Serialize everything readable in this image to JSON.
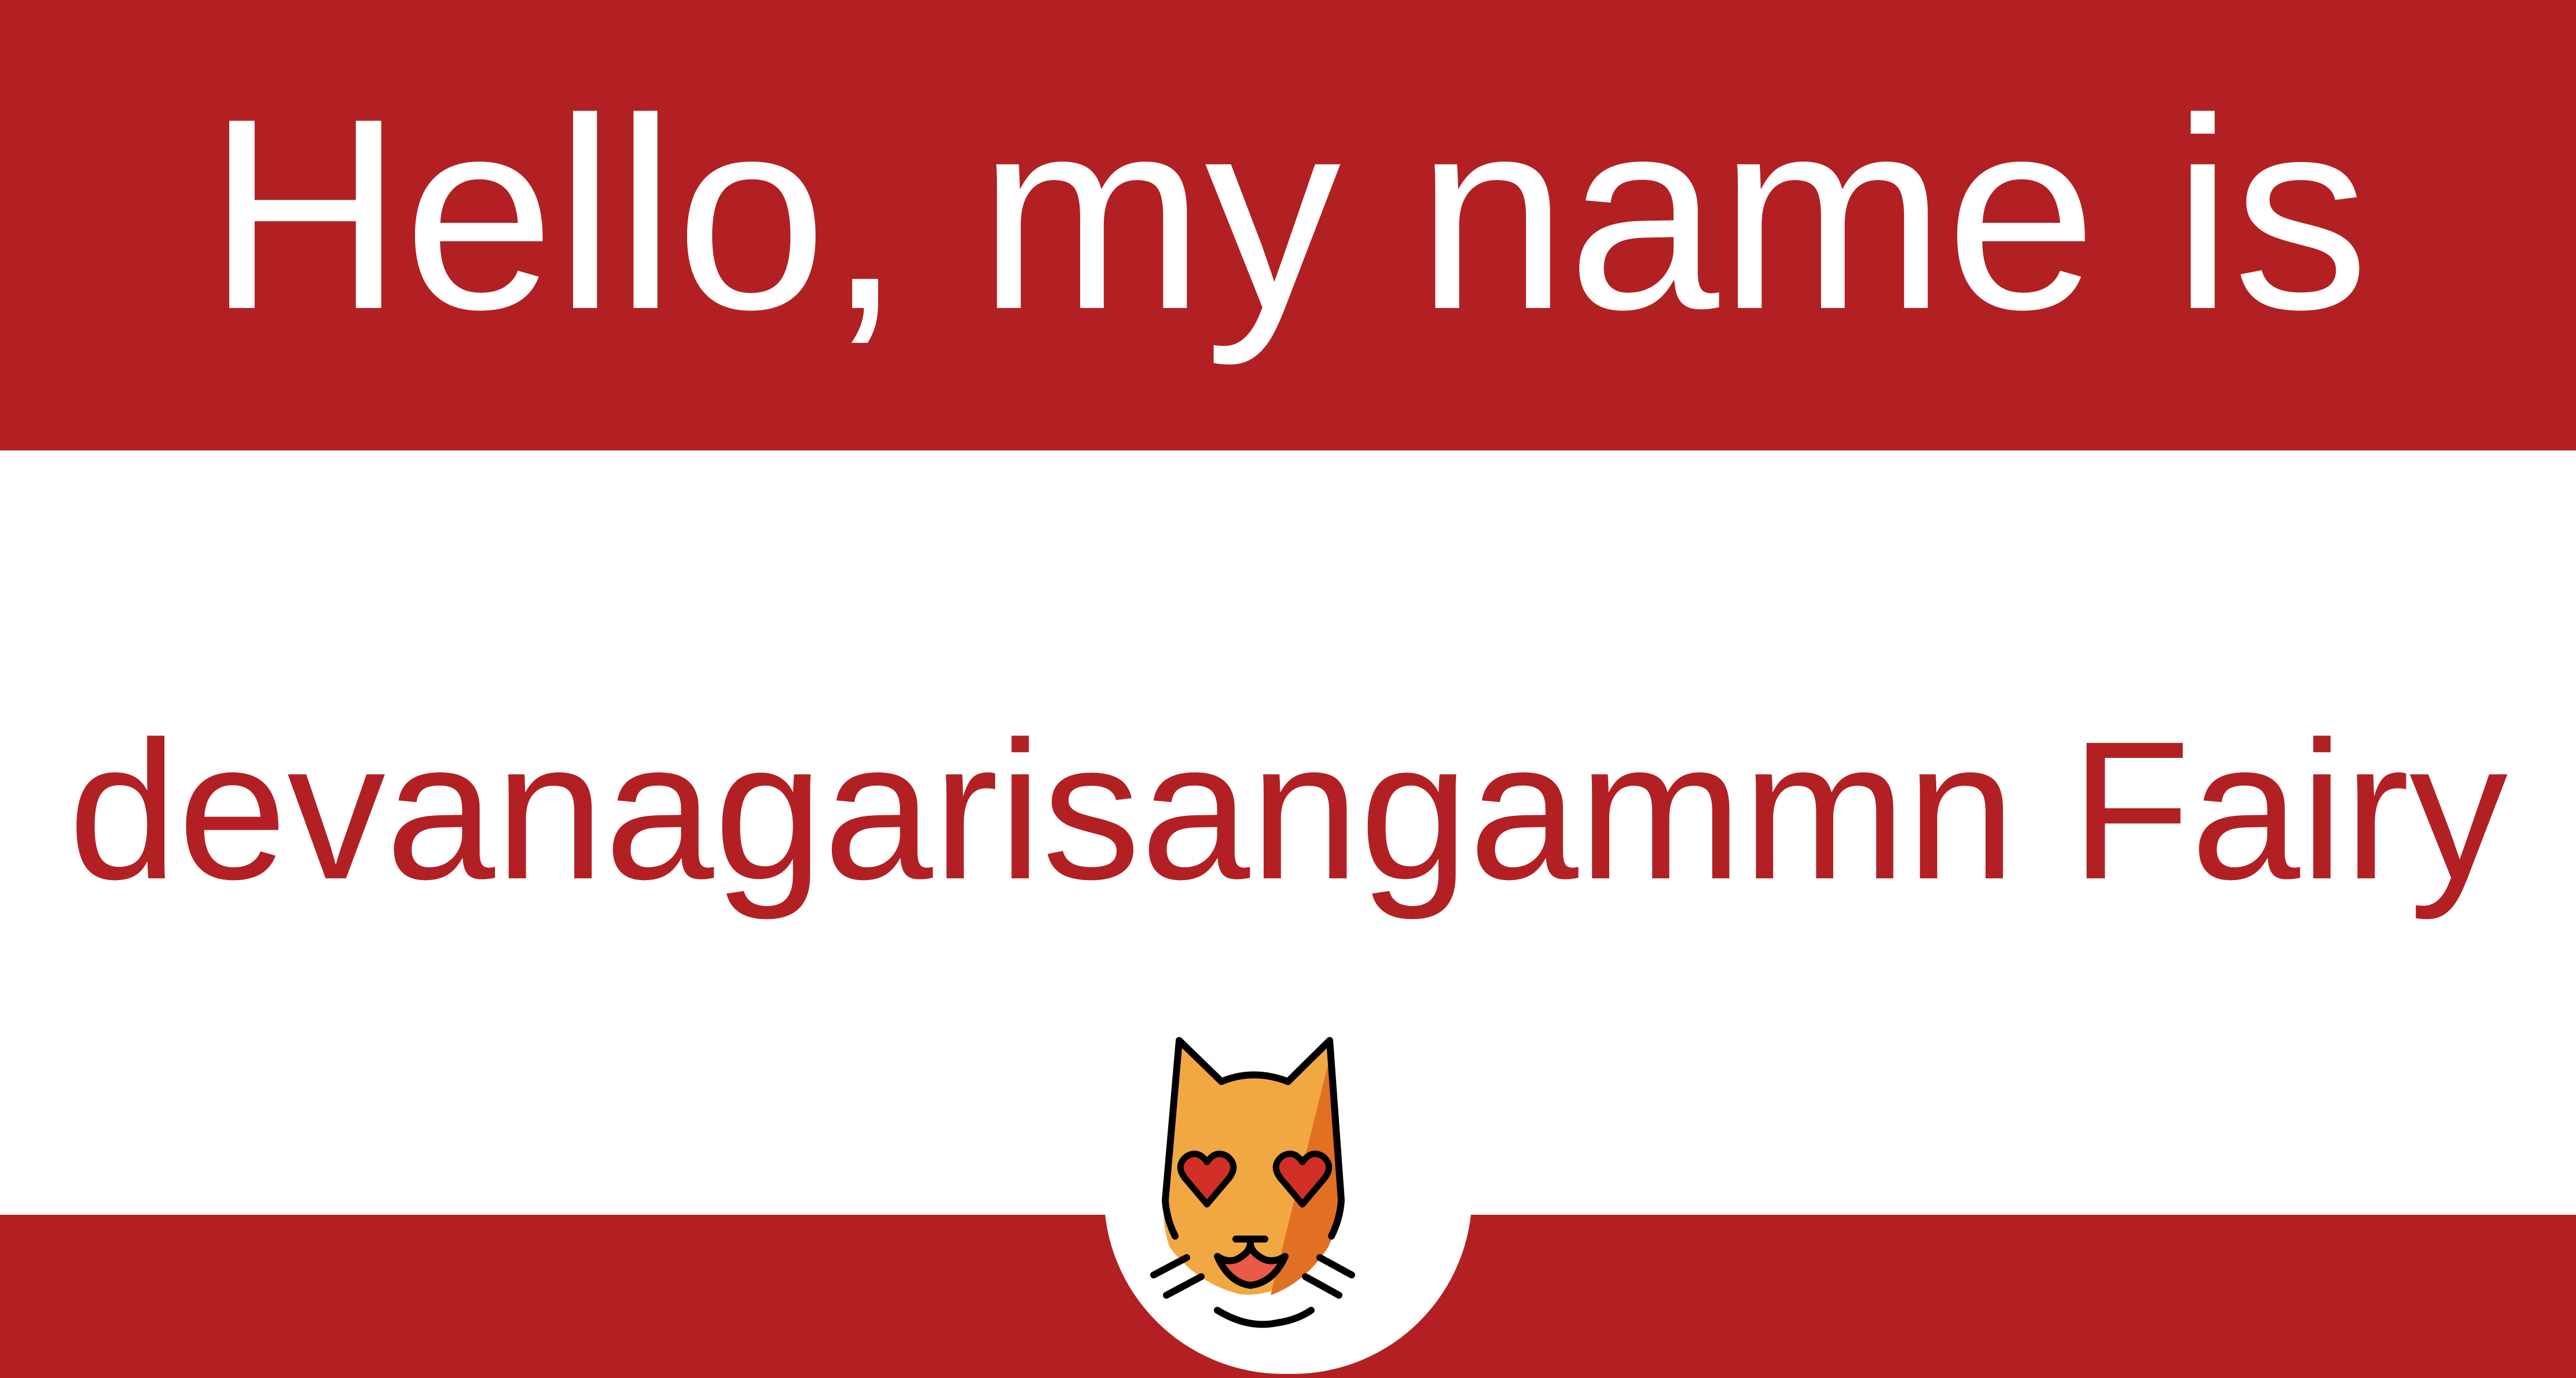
{
  "badge": {
    "greeting": "Hello, my name is",
    "name": "devanagarisangammn Fairy",
    "emblem_icon": "smiling-cat-with-heart-eyes-icon"
  },
  "colors": {
    "brand_red": "#b22024",
    "background": "#ffffff",
    "greeting_text": "#ffffff",
    "name_text": "#b22024",
    "cat_fur": "#f1a843",
    "cat_fur_shade": "#e27022",
    "cat_hearts": "#d22f27",
    "cat_mouth": "#ea5a47"
  }
}
